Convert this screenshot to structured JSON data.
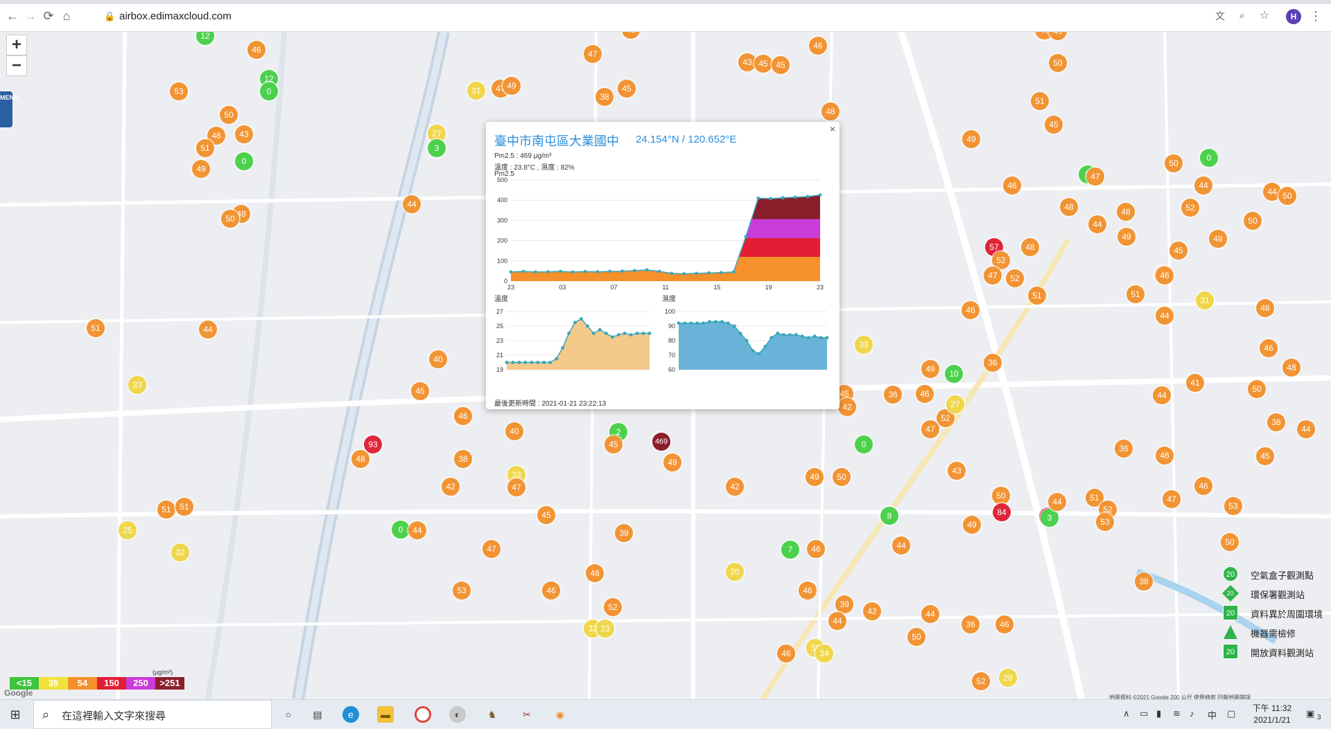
{
  "browser": {
    "url": "airbox.edimaxcloud.com",
    "avatar_letter": "H"
  },
  "map": {
    "zoom_in": "+",
    "zoom_out": "−",
    "menu_label": "MENU",
    "google_logo": "Google",
    "attribution": "地圖資料 ©2021 Google   200 公尺        使用條款   回報地圖錯誤",
    "markers": [
      {
        "v": "12",
        "c": "green"
      },
      {
        "v": "46",
        "c": "orange"
      },
      {
        "v": "12",
        "c": "green"
      },
      {
        "v": "0",
        "c": "green"
      },
      {
        "v": "53",
        "c": "orange"
      },
      {
        "v": "50",
        "c": "orange"
      },
      {
        "v": "48",
        "c": "orange"
      },
      {
        "v": "43",
        "c": "orange"
      },
      {
        "v": "51",
        "c": "orange"
      },
      {
        "v": "0",
        "c": "green"
      },
      {
        "v": "49",
        "c": "orange"
      },
      {
        "v": "48",
        "c": "orange"
      },
      {
        "v": "50",
        "c": "orange"
      },
      {
        "v": "44",
        "c": "orange"
      },
      {
        "v": "27",
        "c": "yellow"
      },
      {
        "v": "3",
        "c": "green"
      },
      {
        "v": "31",
        "c": "yellow"
      },
      {
        "v": "47",
        "c": "orange"
      },
      {
        "v": "49",
        "c": "orange"
      },
      {
        "v": "47",
        "c": "orange"
      },
      {
        "v": "48",
        "c": "orange"
      },
      {
        "v": "38",
        "c": "orange"
      },
      {
        "v": "45",
        "c": "orange"
      },
      {
        "v": "43",
        "c": "orange"
      },
      {
        "v": "45",
        "c": "orange"
      },
      {
        "v": "45",
        "c": "orange"
      },
      {
        "v": "46",
        "c": "orange"
      },
      {
        "v": "48",
        "c": "orange"
      },
      {
        "v": "51",
        "c": "orange"
      },
      {
        "v": "44",
        "c": "orange"
      },
      {
        "v": "33",
        "c": "yellow"
      },
      {
        "v": "40",
        "c": "orange"
      },
      {
        "v": "45",
        "c": "orange"
      },
      {
        "v": "46",
        "c": "orange"
      },
      {
        "v": "40",
        "c": "orange"
      },
      {
        "v": "93",
        "c": "red"
      },
      {
        "v": "48",
        "c": "orange"
      },
      {
        "v": "38",
        "c": "orange"
      },
      {
        "v": "42",
        "c": "orange"
      },
      {
        "v": "33",
        "c": "yellow"
      },
      {
        "v": "47",
        "c": "orange"
      },
      {
        "v": "51",
        "c": "orange"
      },
      {
        "v": "51",
        "c": "orange"
      },
      {
        "v": "25",
        "c": "yellow"
      },
      {
        "v": "32",
        "c": "yellow"
      },
      {
        "v": "0",
        "c": "green"
      },
      {
        "v": "44",
        "c": "orange"
      },
      {
        "v": "45",
        "c": "orange"
      },
      {
        "v": "47",
        "c": "orange"
      },
      {
        "v": "39",
        "c": "orange"
      },
      {
        "v": "53",
        "c": "orange"
      },
      {
        "v": "46",
        "c": "orange"
      },
      {
        "v": "48",
        "c": "orange"
      },
      {
        "v": "52",
        "c": "orange"
      },
      {
        "v": "33",
        "c": "yellow"
      },
      {
        "v": "23",
        "c": "yellow"
      },
      {
        "v": "2",
        "c": "green"
      },
      {
        "v": "45",
        "c": "orange"
      },
      {
        "v": "469",
        "c": "darkred"
      },
      {
        "v": "49",
        "c": "orange"
      },
      {
        "v": "42",
        "c": "orange"
      },
      {
        "v": "49",
        "c": "orange"
      },
      {
        "v": "50",
        "c": "orange"
      },
      {
        "v": "7",
        "c": "green"
      },
      {
        "v": "46",
        "c": "orange"
      },
      {
        "v": "20",
        "c": "yellow"
      },
      {
        "v": "46",
        "c": "orange"
      },
      {
        "v": "39",
        "c": "orange"
      },
      {
        "v": "44",
        "c": "orange"
      },
      {
        "v": "42",
        "c": "orange"
      },
      {
        "v": "46",
        "c": "orange"
      },
      {
        "v": "33",
        "c": "yellow"
      },
      {
        "v": "34",
        "c": "yellow"
      },
      {
        "v": "45",
        "c": "orange"
      },
      {
        "v": "42",
        "c": "orange"
      },
      {
        "v": "0",
        "c": "green"
      },
      {
        "v": "36",
        "c": "orange"
      },
      {
        "v": "46",
        "c": "orange"
      },
      {
        "v": "52",
        "c": "orange"
      },
      {
        "v": "27",
        "c": "yellow"
      },
      {
        "v": "47",
        "c": "orange"
      },
      {
        "v": "43",
        "c": "orange"
      },
      {
        "v": "8",
        "c": "green"
      },
      {
        "v": "44",
        "c": "orange"
      },
      {
        "v": "49",
        "c": "orange"
      },
      {
        "v": "10",
        "c": "green"
      },
      {
        "v": "33",
        "c": "yellow"
      },
      {
        "v": "46",
        "c": "orange"
      },
      {
        "v": "36",
        "c": "orange"
      },
      {
        "v": "50",
        "c": "orange"
      },
      {
        "v": "44",
        "c": "orange"
      },
      {
        "v": "36",
        "c": "orange"
      },
      {
        "v": "46",
        "c": "orange"
      },
      {
        "v": "52",
        "c": "orange"
      },
      {
        "v": "28",
        "c": "yellow"
      },
      {
        "v": "49",
        "c": "orange"
      },
      {
        "v": "50",
        "c": "orange"
      },
      {
        "v": "84",
        "c": "red"
      },
      {
        "v": "55",
        "c": "red"
      },
      {
        "v": "3",
        "c": "green"
      },
      {
        "v": "44",
        "c": "orange"
      },
      {
        "v": "51",
        "c": "orange"
      },
      {
        "v": "52",
        "c": "orange"
      },
      {
        "v": "53",
        "c": "orange"
      },
      {
        "v": "38",
        "c": "orange"
      },
      {
        "v": "36",
        "c": "orange"
      },
      {
        "v": "46",
        "c": "orange"
      },
      {
        "v": "47",
        "c": "orange"
      },
      {
        "v": "46",
        "c": "orange"
      },
      {
        "v": "50",
        "c": "orange"
      },
      {
        "v": "53",
        "c": "orange"
      },
      {
        "v": "45",
        "c": "orange"
      },
      {
        "v": "44",
        "c": "orange"
      },
      {
        "v": "38",
        "c": "orange"
      },
      {
        "v": "46",
        "c": "orange"
      },
      {
        "v": "50",
        "c": "orange"
      },
      {
        "v": "44",
        "c": "orange"
      },
      {
        "v": "51",
        "c": "orange"
      },
      {
        "v": "47",
        "c": "orange"
      },
      {
        "v": "57",
        "c": "red"
      },
      {
        "v": "52",
        "c": "orange"
      },
      {
        "v": "47",
        "c": "orange"
      },
      {
        "v": "48",
        "c": "orange"
      },
      {
        "v": "52",
        "c": "orange"
      },
      {
        "v": "51",
        "c": "orange"
      },
      {
        "v": "48",
        "c": "orange"
      },
      {
        "v": "44",
        "c": "orange"
      },
      {
        "v": "48",
        "c": "orange"
      },
      {
        "v": "46",
        "c": "orange"
      },
      {
        "v": "49",
        "c": "orange"
      },
      {
        "v": "45",
        "c": "orange"
      },
      {
        "v": "5",
        "c": "green"
      },
      {
        "v": "47",
        "c": "orange"
      },
      {
        "v": "49",
        "c": "orange"
      },
      {
        "v": "52",
        "c": "orange"
      },
      {
        "v": "44",
        "c": "orange"
      },
      {
        "v": "50",
        "c": "orange"
      },
      {
        "v": "0",
        "c": "green"
      },
      {
        "v": "48",
        "c": "orange"
      },
      {
        "v": "50",
        "c": "orange"
      },
      {
        "v": "44",
        "c": "orange"
      },
      {
        "v": "50",
        "c": "orange"
      },
      {
        "v": "38",
        "c": "orange"
      },
      {
        "v": "45",
        "c": "orange"
      },
      {
        "v": "46",
        "c": "orange"
      },
      {
        "v": "31",
        "c": "yellow"
      },
      {
        "v": "48",
        "c": "orange"
      },
      {
        "v": "44",
        "c": "orange"
      },
      {
        "v": "41",
        "c": "orange"
      },
      {
        "v": "48",
        "c": "orange"
      },
      {
        "v": "50",
        "c": "orange"
      },
      {
        "v": "49",
        "c": "orange"
      },
      {
        "v": "47",
        "c": "orange"
      },
      {
        "v": "49",
        "c": "orange"
      },
      {
        "v": "51",
        "c": "orange"
      }
    ]
  },
  "popup": {
    "title": "臺中市南屯區大業國中",
    "coords": "24.154°N / 120.652°E",
    "pm_line": "Pm2.5 : 469 μg/m³",
    "env_line": "溫度 : 23.8°C , 濕度 : 82%",
    "pm_label": "Pm2.5",
    "temp_label": "溫度",
    "hum_label": "濕度",
    "update": "最後更新時間 : 2021-01-21 23:22:13",
    "close": "×"
  },
  "chart_data": [
    {
      "type": "area",
      "title": "Pm2.5",
      "categories": [
        "23",
        "",
        "",
        "",
        "",
        "03",
        "",
        "",
        "",
        "07",
        "",
        "",
        "",
        "11",
        "",
        "",
        "",
        "15",
        "",
        "",
        "",
        "19",
        "",
        "",
        "",
        "23"
      ],
      "x_ticks": [
        "23",
        "03",
        "07",
        "11",
        "15",
        "19",
        "23"
      ],
      "y_ticks": [
        "0",
        "100",
        "200",
        "300",
        "400",
        "500"
      ],
      "ylim": [
        0,
        500
      ],
      "series": [
        {
          "values": [
            45,
            48,
            45,
            46,
            48,
            45,
            47,
            46,
            48,
            49,
            52,
            55,
            48,
            38,
            36,
            38,
            40,
            42,
            45,
            220,
            410,
            408,
            412,
            415,
            418,
            426
          ]
        }
      ]
    },
    {
      "type": "area",
      "title": "溫度",
      "y_ticks": [
        "19",
        "21",
        "23",
        "25",
        "27"
      ],
      "ylim": [
        19,
        27
      ],
      "series": [
        {
          "values": [
            20,
            20,
            20,
            20,
            20,
            20,
            20,
            20,
            20.5,
            22,
            24,
            25.5,
            26,
            25,
            24,
            24.5,
            24,
            23.5,
            23.8,
            24,
            23.8,
            24,
            24,
            24
          ]
        }
      ]
    },
    {
      "type": "area",
      "title": "濕度",
      "y_ticks": [
        "60",
        "70",
        "80",
        "90",
        "100"
      ],
      "ylim": [
        60,
        100
      ],
      "series": [
        {
          "values": [
            92,
            92,
            92,
            92,
            92,
            93,
            93,
            93,
            92,
            90,
            85,
            80,
            73,
            71,
            76,
            82,
            85,
            84,
            84,
            84,
            83,
            82,
            83,
            82,
            82
          ]
        }
      ]
    }
  ],
  "legend_scale": {
    "unit": "(μg/m³)",
    "items": [
      {
        "label": "<15",
        "color": "#3ec53e"
      },
      {
        "label": "35",
        "color": "#f2e33a"
      },
      {
        "label": "54",
        "color": "#f5902b"
      },
      {
        "label": "150",
        "color": "#e21e34"
      },
      {
        "label": "250",
        "color": "#c93cd9"
      },
      {
        "label": ">251",
        "color": "#8b1e2b"
      }
    ]
  },
  "legend_types": [
    {
      "num": "20",
      "label": "空氣盒子觀測點"
    },
    {
      "num": "20",
      "label": "環保署觀測站"
    },
    {
      "num": "20",
      "label": "資料異於周圍環境"
    },
    {
      "num": "",
      "label": "機器需檢修"
    },
    {
      "num": "20",
      "label": "開放資料觀測站"
    }
  ],
  "taskbar": {
    "search_placeholder": "在這裡輸入文字來搜尋",
    "time": "下午 11:32",
    "date": "2021/1/21",
    "ime": "中",
    "notify_count": "3"
  },
  "colors": {
    "green": "#4cd14c",
    "yellow": "#f0d64a",
    "orange": "#f29433",
    "red": "#e0253a",
    "darkred": "#8b1e2b",
    "popup_title": "#2b8ed8"
  }
}
